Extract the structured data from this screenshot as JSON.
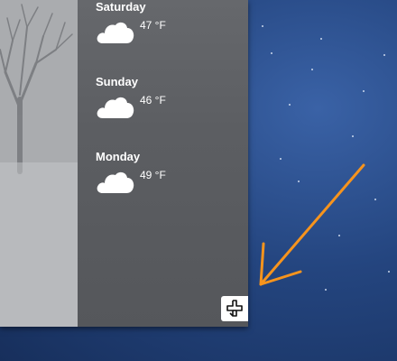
{
  "forecast": {
    "days": [
      {
        "name": "Saturday",
        "temp": "47 °F",
        "icon": "cloud-icon"
      },
      {
        "name": "Sunday",
        "temp": "46 °F",
        "icon": "cloud-icon"
      },
      {
        "name": "Monday",
        "temp": "49 °F",
        "icon": "cloud-icon"
      }
    ]
  },
  "snap_button": {
    "icon": "snap-window-icon"
  },
  "annotation": {
    "icon": "arrow-pointer-icon",
    "color": "#f7941d"
  },
  "colors": {
    "forecast_bg": "#5c5e62",
    "photo_bg": "#b3b5b8",
    "desktop_bg": "#24457f",
    "text": "#ffffff"
  }
}
